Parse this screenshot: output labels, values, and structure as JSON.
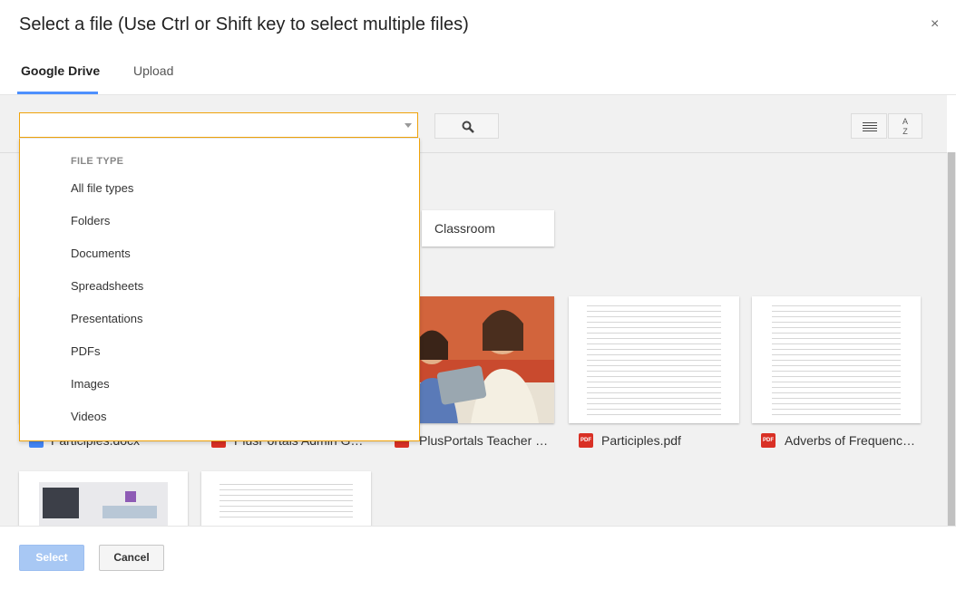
{
  "dialog": {
    "title": "Select a file (Use Ctrl or Shift key to select multiple files)",
    "close_label": "×"
  },
  "tabs": [
    {
      "label": "Google Drive",
      "active": true
    },
    {
      "label": "Upload",
      "active": false
    }
  ],
  "search": {
    "value": "",
    "placeholder": ""
  },
  "toolbar": {
    "sort_label_top": "A",
    "sort_label_bottom": "Z"
  },
  "filter_menu": {
    "header": "FILE TYPE",
    "items": [
      "All file types",
      "Folders",
      "Documents",
      "Spreadsheets",
      "Presentations",
      "PDFs",
      "Images",
      "Videos"
    ]
  },
  "folders": [
    {
      "name": "Classroom"
    }
  ],
  "files": [
    {
      "name": "Participles.docx",
      "type": "doc"
    },
    {
      "name": "PlusPortals Admin Gui...",
      "type": "slides"
    },
    {
      "name": "PlusPortals Teacher G...",
      "type": "slides"
    },
    {
      "name": "Participles.pdf",
      "type": "pdf"
    },
    {
      "name": "Adverbs of Frequency....",
      "type": "pdf"
    }
  ],
  "footer": {
    "select_label": "Select",
    "cancel_label": "Cancel"
  },
  "colors": {
    "focus_border": "#f0a30a",
    "accent": "#4d90fe",
    "pdf": "#d93025",
    "doc": "#4285f4"
  },
  "icons": {
    "close": "close-icon",
    "search": "search-icon",
    "list": "list-view-icon",
    "sort": "sort-az-icon",
    "pdf": "pdf-icon"
  }
}
